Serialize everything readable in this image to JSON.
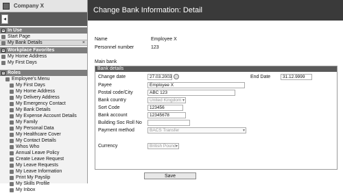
{
  "company": {
    "name": "Company X"
  },
  "sidebar": {
    "in_use_title": "In Use",
    "in_use_items": [
      {
        "label": "Start Page"
      },
      {
        "label": "My Bank Details",
        "close": "×"
      }
    ],
    "favorites_title": "Workplace Favorites",
    "favorites": [
      {
        "label": "My Home Address"
      },
      {
        "label": "My First Days"
      }
    ],
    "roles_title": "Roles",
    "roles_root": "Employee's Menu",
    "roles_items": [
      "My First Days",
      "My Home Address",
      "My Delivery Address",
      "My Emergency Contact",
      "My Bank Details",
      "My Expense Account Details",
      "My Family",
      "My Personal Data",
      "My Healthcare Cover",
      "My Contact Details",
      "Whos Who",
      "Annual Leave Policy",
      "Create Leave Request",
      "My Leave Requests",
      "My Leave Information",
      "Print My Payslip",
      "My Skills Profile",
      "My Inbox"
    ]
  },
  "header": {
    "title": "Change Bank Information: Detail"
  },
  "info": {
    "name_label": "Name",
    "name_value": "Employee X",
    "personnel_label": "Personnel number",
    "personnel_value": "123",
    "main_bank_label": "Main bank"
  },
  "bank": {
    "group_title": "Bank details",
    "change_date_label": "Change date",
    "change_date_value": "27.03.2003",
    "end_date_label": "End Date",
    "end_date_value": "31.12.9999",
    "payee_label": "Payee",
    "payee_value": "Employee X",
    "postal_label": "Postal code/City",
    "postal_value": "ABC 123",
    "country_label": "Bank country",
    "country_value": "United Kingdom",
    "sort_label": "Sort Code",
    "sort_value": "123456",
    "account_label": "Bank account",
    "account_value": "12345678",
    "roll_label": "Building Soc Roll No",
    "roll_value": "",
    "payment_label": "Payment method",
    "payment_value": "BACS Transfer",
    "currency_label": "Currency",
    "currency_value": "British Pound"
  },
  "actions": {
    "save_label": "Save"
  }
}
